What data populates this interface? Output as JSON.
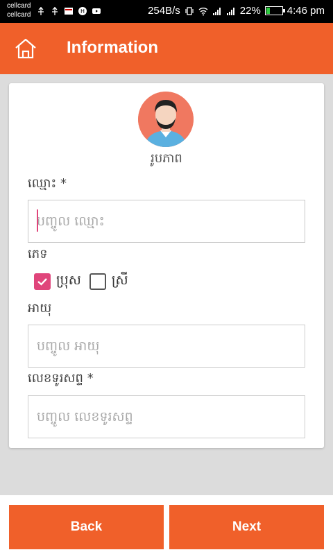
{
  "status_bar": {
    "carrier_1": "cellcard",
    "carrier_2": "cellcard",
    "net_speed": "254B/s",
    "battery": "22%",
    "battery_level": 0.22,
    "time": "4:46 pm"
  },
  "app_bar": {
    "title": "Information",
    "color": "#f0602a"
  },
  "form": {
    "photo_label": "រូបភាព",
    "name": {
      "label": "ឈ្មោះ",
      "required_mark": "*",
      "value": "",
      "placeholder": "បញ្ចូល ឈ្មោះ"
    },
    "gender": {
      "label": "ភេទ",
      "options": [
        {
          "label": "ប្រុស",
          "checked": true
        },
        {
          "label": "ស្រី",
          "checked": false
        }
      ]
    },
    "age": {
      "label": "អាយុ",
      "value": "",
      "placeholder": "បញ្ចូល អាយុ"
    },
    "phone": {
      "label": "លេខទូរសព្ទ",
      "required_mark": "*",
      "value": "",
      "placeholder": "បញ្ចូល លេខទូរសព្ទ"
    }
  },
  "buttons": {
    "back": "Back",
    "next": "Next"
  },
  "colors": {
    "accent": "#f0602a",
    "checkbox": "#e0457b"
  }
}
